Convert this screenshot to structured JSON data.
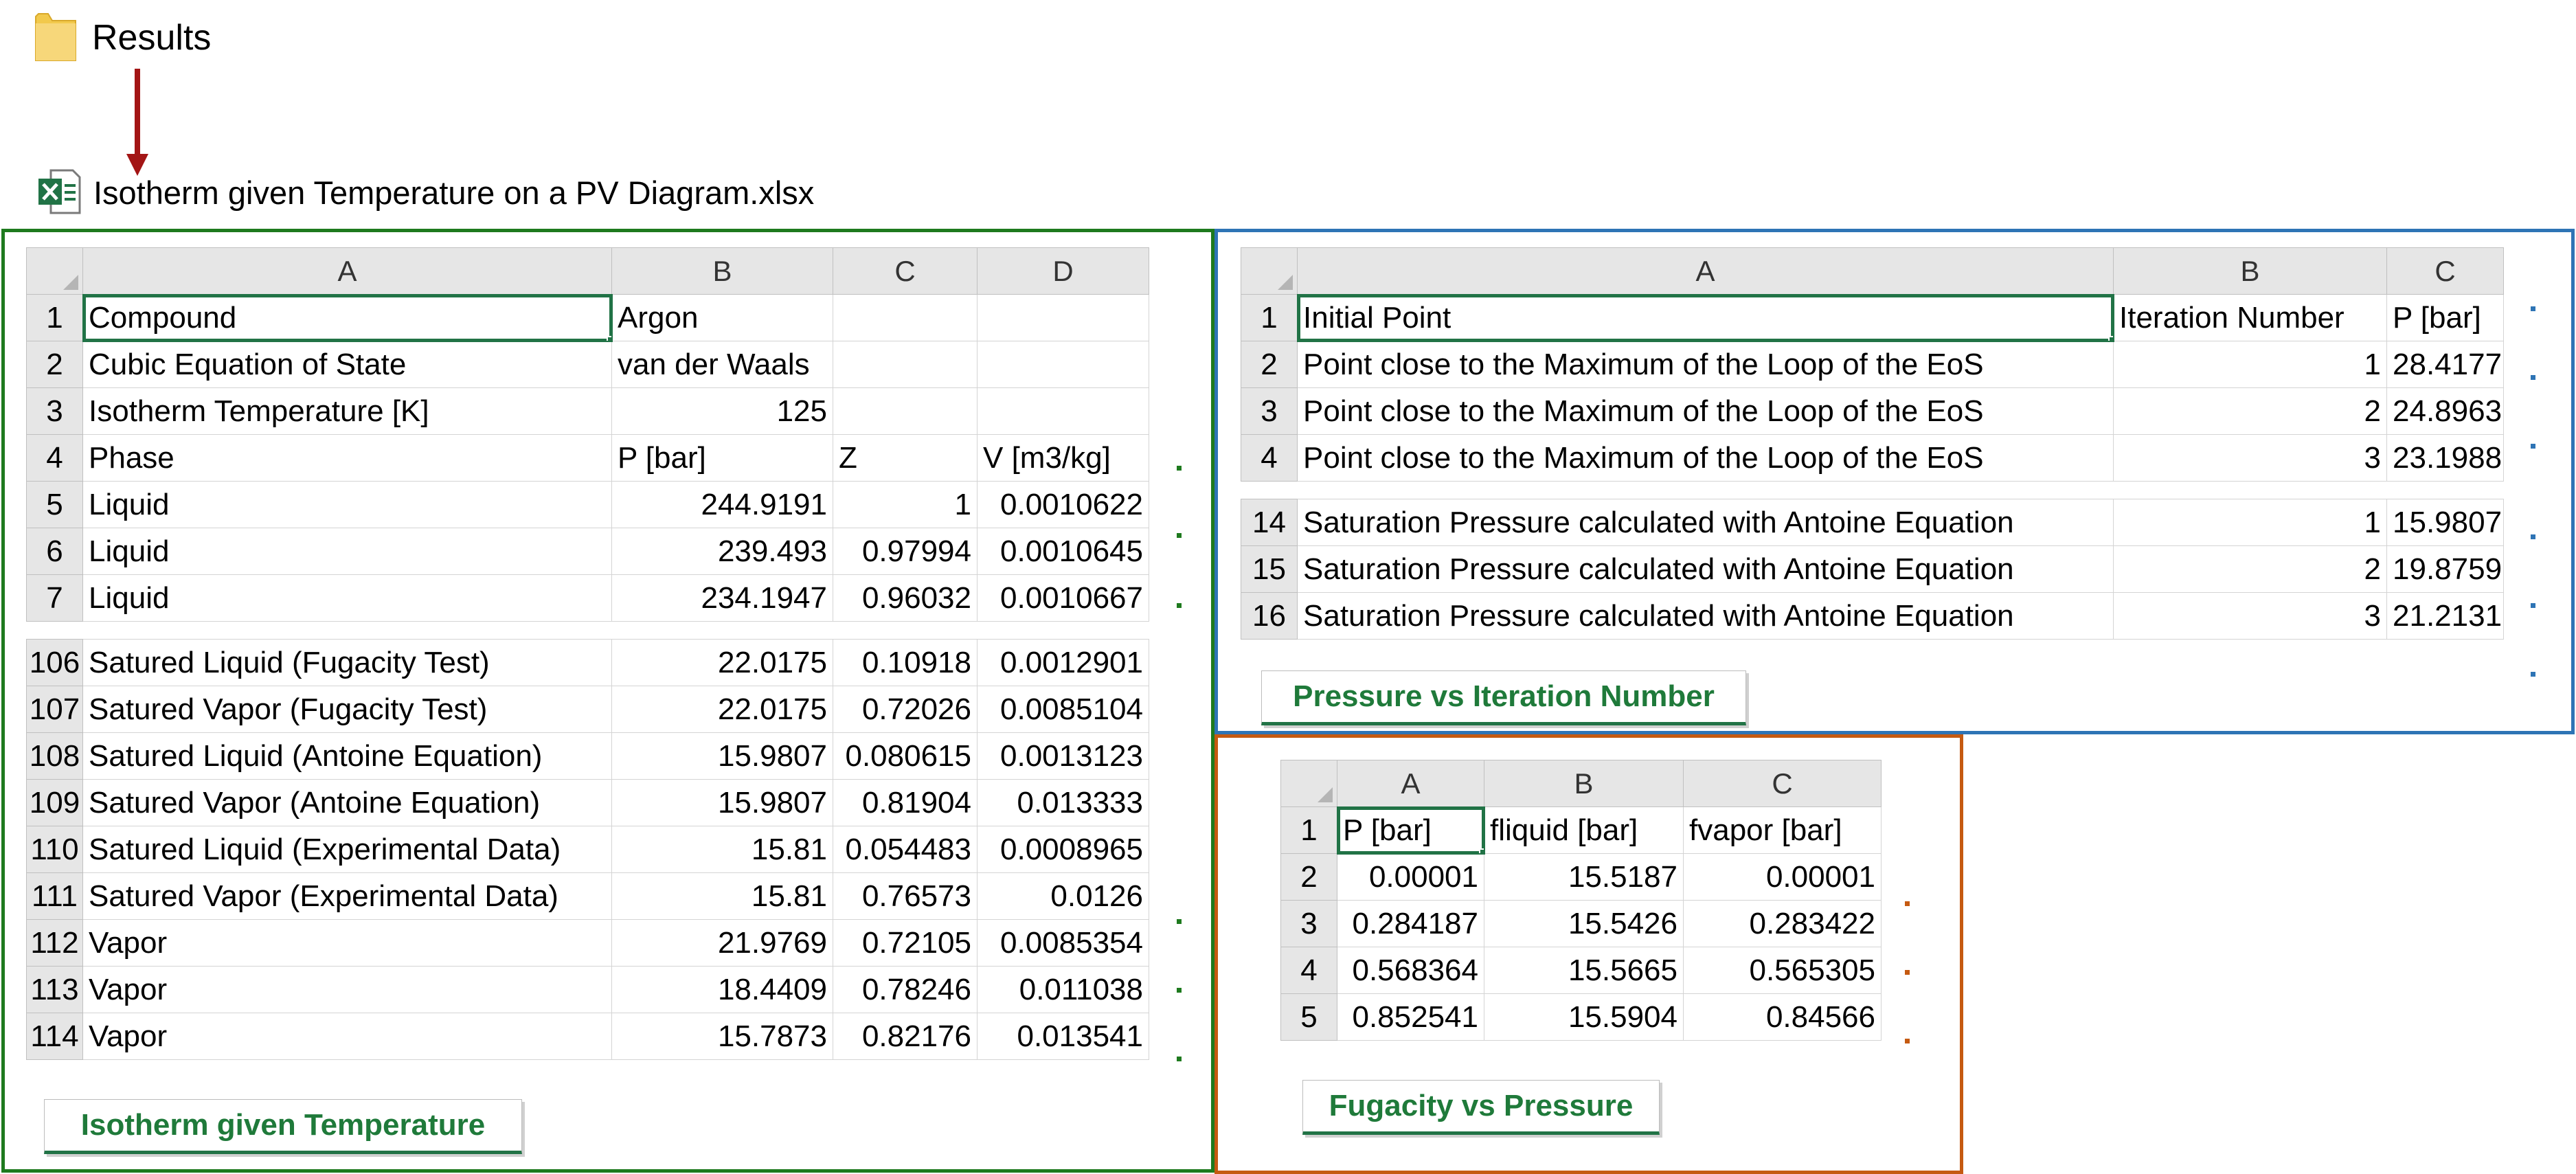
{
  "header": {
    "folder_icon": "folder-icon",
    "folder_label": "Results",
    "file_icon": "excel-file-icon",
    "file_label": "Isotherm given Temperature on a PV Diagram.xlsx"
  },
  "colors": {
    "green_frame": "#1e7a1e",
    "blue_frame": "#2e74b5",
    "orange_frame": "#c55a11",
    "arrow": "#a31515",
    "excel_green": "#217346"
  },
  "sheet1": {
    "columns": [
      "A",
      "B",
      "C",
      "D"
    ],
    "rows_top": [
      {
        "n": "1",
        "a": "Compound",
        "b": "Argon",
        "c": "",
        "d": ""
      },
      {
        "n": "2",
        "a": "Cubic Equation of State",
        "b": "van der Waals",
        "c": "",
        "d": ""
      },
      {
        "n": "3",
        "a": "Isotherm Temperature [K]",
        "b": "125",
        "c": "",
        "d": ""
      },
      {
        "n": "4",
        "a": "Phase",
        "b": "P [bar]",
        "c": "Z",
        "d": "V [m3/kg]"
      },
      {
        "n": "5",
        "a": "Liquid",
        "b": "244.9191",
        "c": "1",
        "d": "0.0010622"
      },
      {
        "n": "6",
        "a": "Liquid",
        "b": "239.493",
        "c": "0.97994",
        "d": "0.0010645"
      },
      {
        "n": "7",
        "a": "Liquid",
        "b": "234.1947",
        "c": "0.96032",
        "d": "0.0010667"
      }
    ],
    "rows_bottom": [
      {
        "n": "106",
        "a": "Satured Liquid (Fugacity Test)",
        "b": "22.0175",
        "c": "0.10918",
        "d": "0.0012901"
      },
      {
        "n": "107",
        "a": "Satured Vapor (Fugacity Test)",
        "b": "22.0175",
        "c": "0.72026",
        "d": "0.0085104"
      },
      {
        "n": "108",
        "a": "Satured Liquid (Antoine Equation)",
        "b": "15.9807",
        "c": "0.080615",
        "d": "0.0013123"
      },
      {
        "n": "109",
        "a": "Satured Vapor (Antoine Equation)",
        "b": "15.9807",
        "c": "0.81904",
        "d": "0.013333"
      },
      {
        "n": "110",
        "a": "Satured Liquid (Experimental Data)",
        "b": "15.81",
        "c": "0.054483",
        "d": "0.0008965"
      },
      {
        "n": "111",
        "a": "Satured Vapor (Experimental Data)",
        "b": "15.81",
        "c": "0.76573",
        "d": "0.0126"
      },
      {
        "n": "112",
        "a": "Vapor",
        "b": "21.9769",
        "c": "0.72105",
        "d": "0.0085354"
      },
      {
        "n": "113",
        "a": "Vapor",
        "b": "18.4409",
        "c": "0.78246",
        "d": "0.011038"
      },
      {
        "n": "114",
        "a": "Vapor",
        "b": "15.7873",
        "c": "0.82176",
        "d": "0.013541"
      }
    ],
    "tab": "Isotherm given Temperature"
  },
  "sheet2": {
    "columns": [
      "A",
      "B",
      "C"
    ],
    "rows_top": [
      {
        "n": "1",
        "a": "Initial Point",
        "b": "Iteration Number",
        "c": "P [bar]"
      },
      {
        "n": "2",
        "a": "Point close to the Maximum of the Loop of the EoS",
        "b": "1",
        "c": "28.4177"
      },
      {
        "n": "3",
        "a": "Point close to the Maximum of the Loop of the EoS",
        "b": "2",
        "c": "24.8963"
      },
      {
        "n": "4",
        "a": "Point close to the Maximum of the Loop of the EoS",
        "b": "3",
        "c": "23.1988"
      }
    ],
    "rows_bottom": [
      {
        "n": "14",
        "a": "Saturation Pressure calculated with Antoine Equation",
        "b": "1",
        "c": "15.9807"
      },
      {
        "n": "15",
        "a": "Saturation Pressure calculated with Antoine Equation",
        "b": "2",
        "c": "19.8759"
      },
      {
        "n": "16",
        "a": "Saturation Pressure calculated with Antoine Equation",
        "b": "3",
        "c": "21.2131"
      }
    ],
    "tab": "Pressure vs Iteration Number"
  },
  "sheet3": {
    "columns": [
      "A",
      "B",
      "C"
    ],
    "rows": [
      {
        "n": "1",
        "a": "P [bar]",
        "b": "fliquid [bar]",
        "c": "fvapor [bar]"
      },
      {
        "n": "2",
        "a": "0.00001",
        "b": "15.5187",
        "c": "0.00001"
      },
      {
        "n": "3",
        "a": "0.284187",
        "b": "15.5426",
        "c": "0.283422"
      },
      {
        "n": "4",
        "a": "0.568364",
        "b": "15.5665",
        "c": "0.565305"
      },
      {
        "n": "5",
        "a": "0.852541",
        "b": "15.5904",
        "c": "0.84566"
      }
    ],
    "tab": "Fugacity vs Pressure"
  }
}
